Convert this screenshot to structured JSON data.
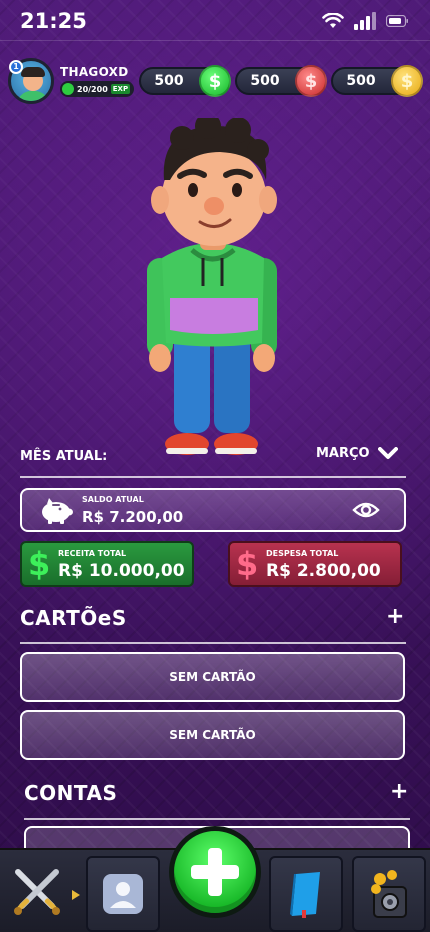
{
  "status_bar": {
    "time": "21:25",
    "icons": [
      "wifi-icon",
      "signal-icon",
      "battery-icon"
    ]
  },
  "player": {
    "level": "1",
    "name": "THAGOXD",
    "exp": "20/200",
    "exp_tag": "EXP"
  },
  "currencies": [
    {
      "amount": "500",
      "icon": "green-dollar-coin-icon",
      "color": "#1fc634"
    },
    {
      "amount": "500",
      "icon": "red-dollar-coin-icon",
      "color": "#d83535"
    },
    {
      "amount": "500",
      "icon": "gold-coin-icon",
      "color": "#f0b51c"
    }
  ],
  "month": {
    "label": "MÊS ATUAL:",
    "value": "MARÇO"
  },
  "balance": {
    "label": "SALDO ATUAL",
    "value": "R$ 7.200,00"
  },
  "income": {
    "label": "RECEITA TOTAL",
    "value": "R$ 10.000,00"
  },
  "expense": {
    "label": "DESPESA TOTAL",
    "value": "R$ 2.800,00"
  },
  "cards_section": {
    "title": "CARTÕeS",
    "add": "+",
    "items": [
      "SEM CARTÃO",
      "SEM CARTÃO"
    ]
  },
  "accounts_section": {
    "title": "CONTAS",
    "add": "+"
  },
  "bottom_nav": {
    "items": [
      "battle-swords-icon",
      "profile-icon",
      "add-transaction-button",
      "book-icon",
      "coin-safe-icon"
    ]
  },
  "colors": {
    "background": "#4a1a6e",
    "income_green": "#2a9a3f",
    "expense_red": "#b8324f",
    "add_button_green": "#2ecc40"
  }
}
